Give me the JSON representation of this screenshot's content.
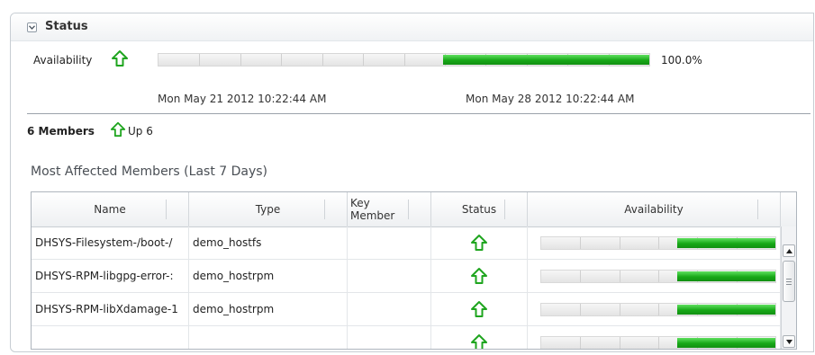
{
  "status_panel": {
    "title": "Status",
    "availability_label": "Availability",
    "availability_value": "100.0%",
    "availability_fraction_up": 0.42,
    "date_start": "Mon May 21 2012 10:22:44 AM",
    "date_end": "Mon May 28 2012 10:22:44 AM"
  },
  "members": {
    "count_label": "6 Members",
    "up_label": "Up 6"
  },
  "affected": {
    "title": "Most Affected Members (Last 7 Days)",
    "columns": {
      "name": "Name",
      "type": "Type",
      "key_member": "Key Member",
      "status": "Status",
      "availability": "Availability"
    },
    "rows": [
      {
        "name": "DHSYS-Filesystem-/boot-/",
        "type": "demo_hostfs",
        "key_member": "",
        "status": "up",
        "availability_fraction_up": 0.42
      },
      {
        "name": "DHSYS-RPM-libgpg-error-:",
        "type": "demo_hostrpm",
        "key_member": "",
        "status": "up",
        "availability_fraction_up": 0.42
      },
      {
        "name": "DHSYS-RPM-libXdamage-1",
        "type": "demo_hostrpm",
        "key_member": "",
        "status": "up",
        "availability_fraction_up": 0.42
      },
      {
        "name": "",
        "type": "",
        "key_member": "",
        "status": "up",
        "availability_fraction_up": 0.42
      }
    ]
  },
  "colors": {
    "up_green": "#18a818",
    "bar_gray": "#e4e4e4",
    "border": "#aeb5bd"
  },
  "icons": {
    "collapse": "chevron-down-icon",
    "status_up": "arrow-up-icon"
  }
}
